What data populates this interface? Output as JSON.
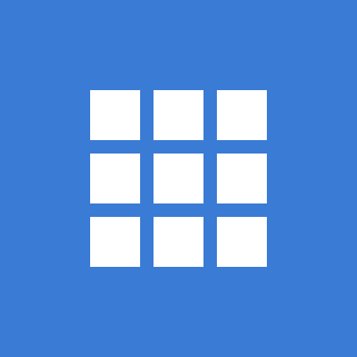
{
  "app_icon": {
    "icon_name": "grid-3x3-icon",
    "background_color": "#3a7bd5",
    "tile_color": "#ffffff",
    "rows": 3,
    "columns": 3
  }
}
